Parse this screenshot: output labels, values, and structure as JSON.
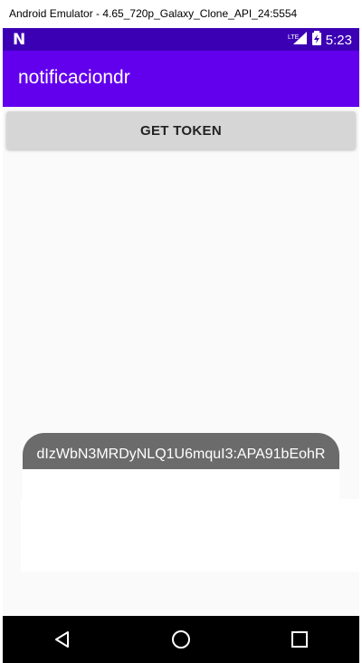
{
  "window": {
    "title": "Android Emulator - 4.65_720p_Galaxy_Clone_API_24:5554"
  },
  "status_bar": {
    "left_icon": "N",
    "network_label": "LTE",
    "time": "5:23"
  },
  "app_bar": {
    "title": "notificaciondr"
  },
  "main": {
    "get_token_label": "GET TOKEN"
  },
  "toast": {
    "text": "dIzWbN3MRDyNLQ1U6mquI3:APA91bEohR"
  },
  "nav": {
    "back_icon": "back-icon",
    "home_icon": "home-icon",
    "recents_icon": "recents-icon"
  },
  "colors": {
    "status": "#3c00b4",
    "primary": "#6200ee",
    "button": "#d6d6d6",
    "toast": "#6b6b6b"
  }
}
